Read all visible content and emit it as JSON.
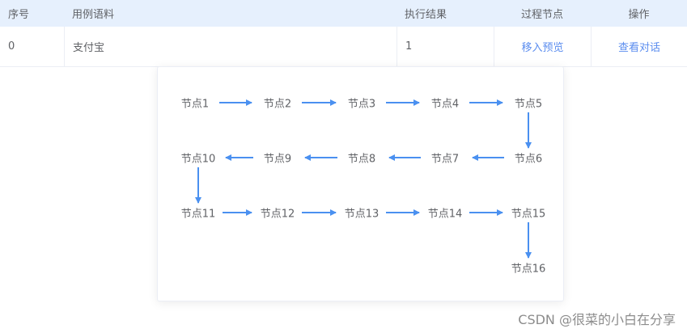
{
  "table": {
    "headers": [
      "序号",
      "用例语料",
      "执行结果",
      "过程节点",
      "操作"
    ],
    "rows": [
      {
        "seq": "0",
        "case": "支付宝",
        "result": "1",
        "nodes_link": "移入预览",
        "action_link": "查看对话"
      }
    ]
  },
  "popover": {
    "nodes": [
      "节点1",
      "节点2",
      "节点3",
      "节点4",
      "节点5",
      "节点6",
      "节点7",
      "节点8",
      "节点9",
      "节点10",
      "节点11",
      "节点12",
      "节点13",
      "节点14",
      "节点15",
      "节点16"
    ],
    "accent_color": "#4a90f0"
  },
  "watermark": "CSDN @很菜的小白在分享"
}
